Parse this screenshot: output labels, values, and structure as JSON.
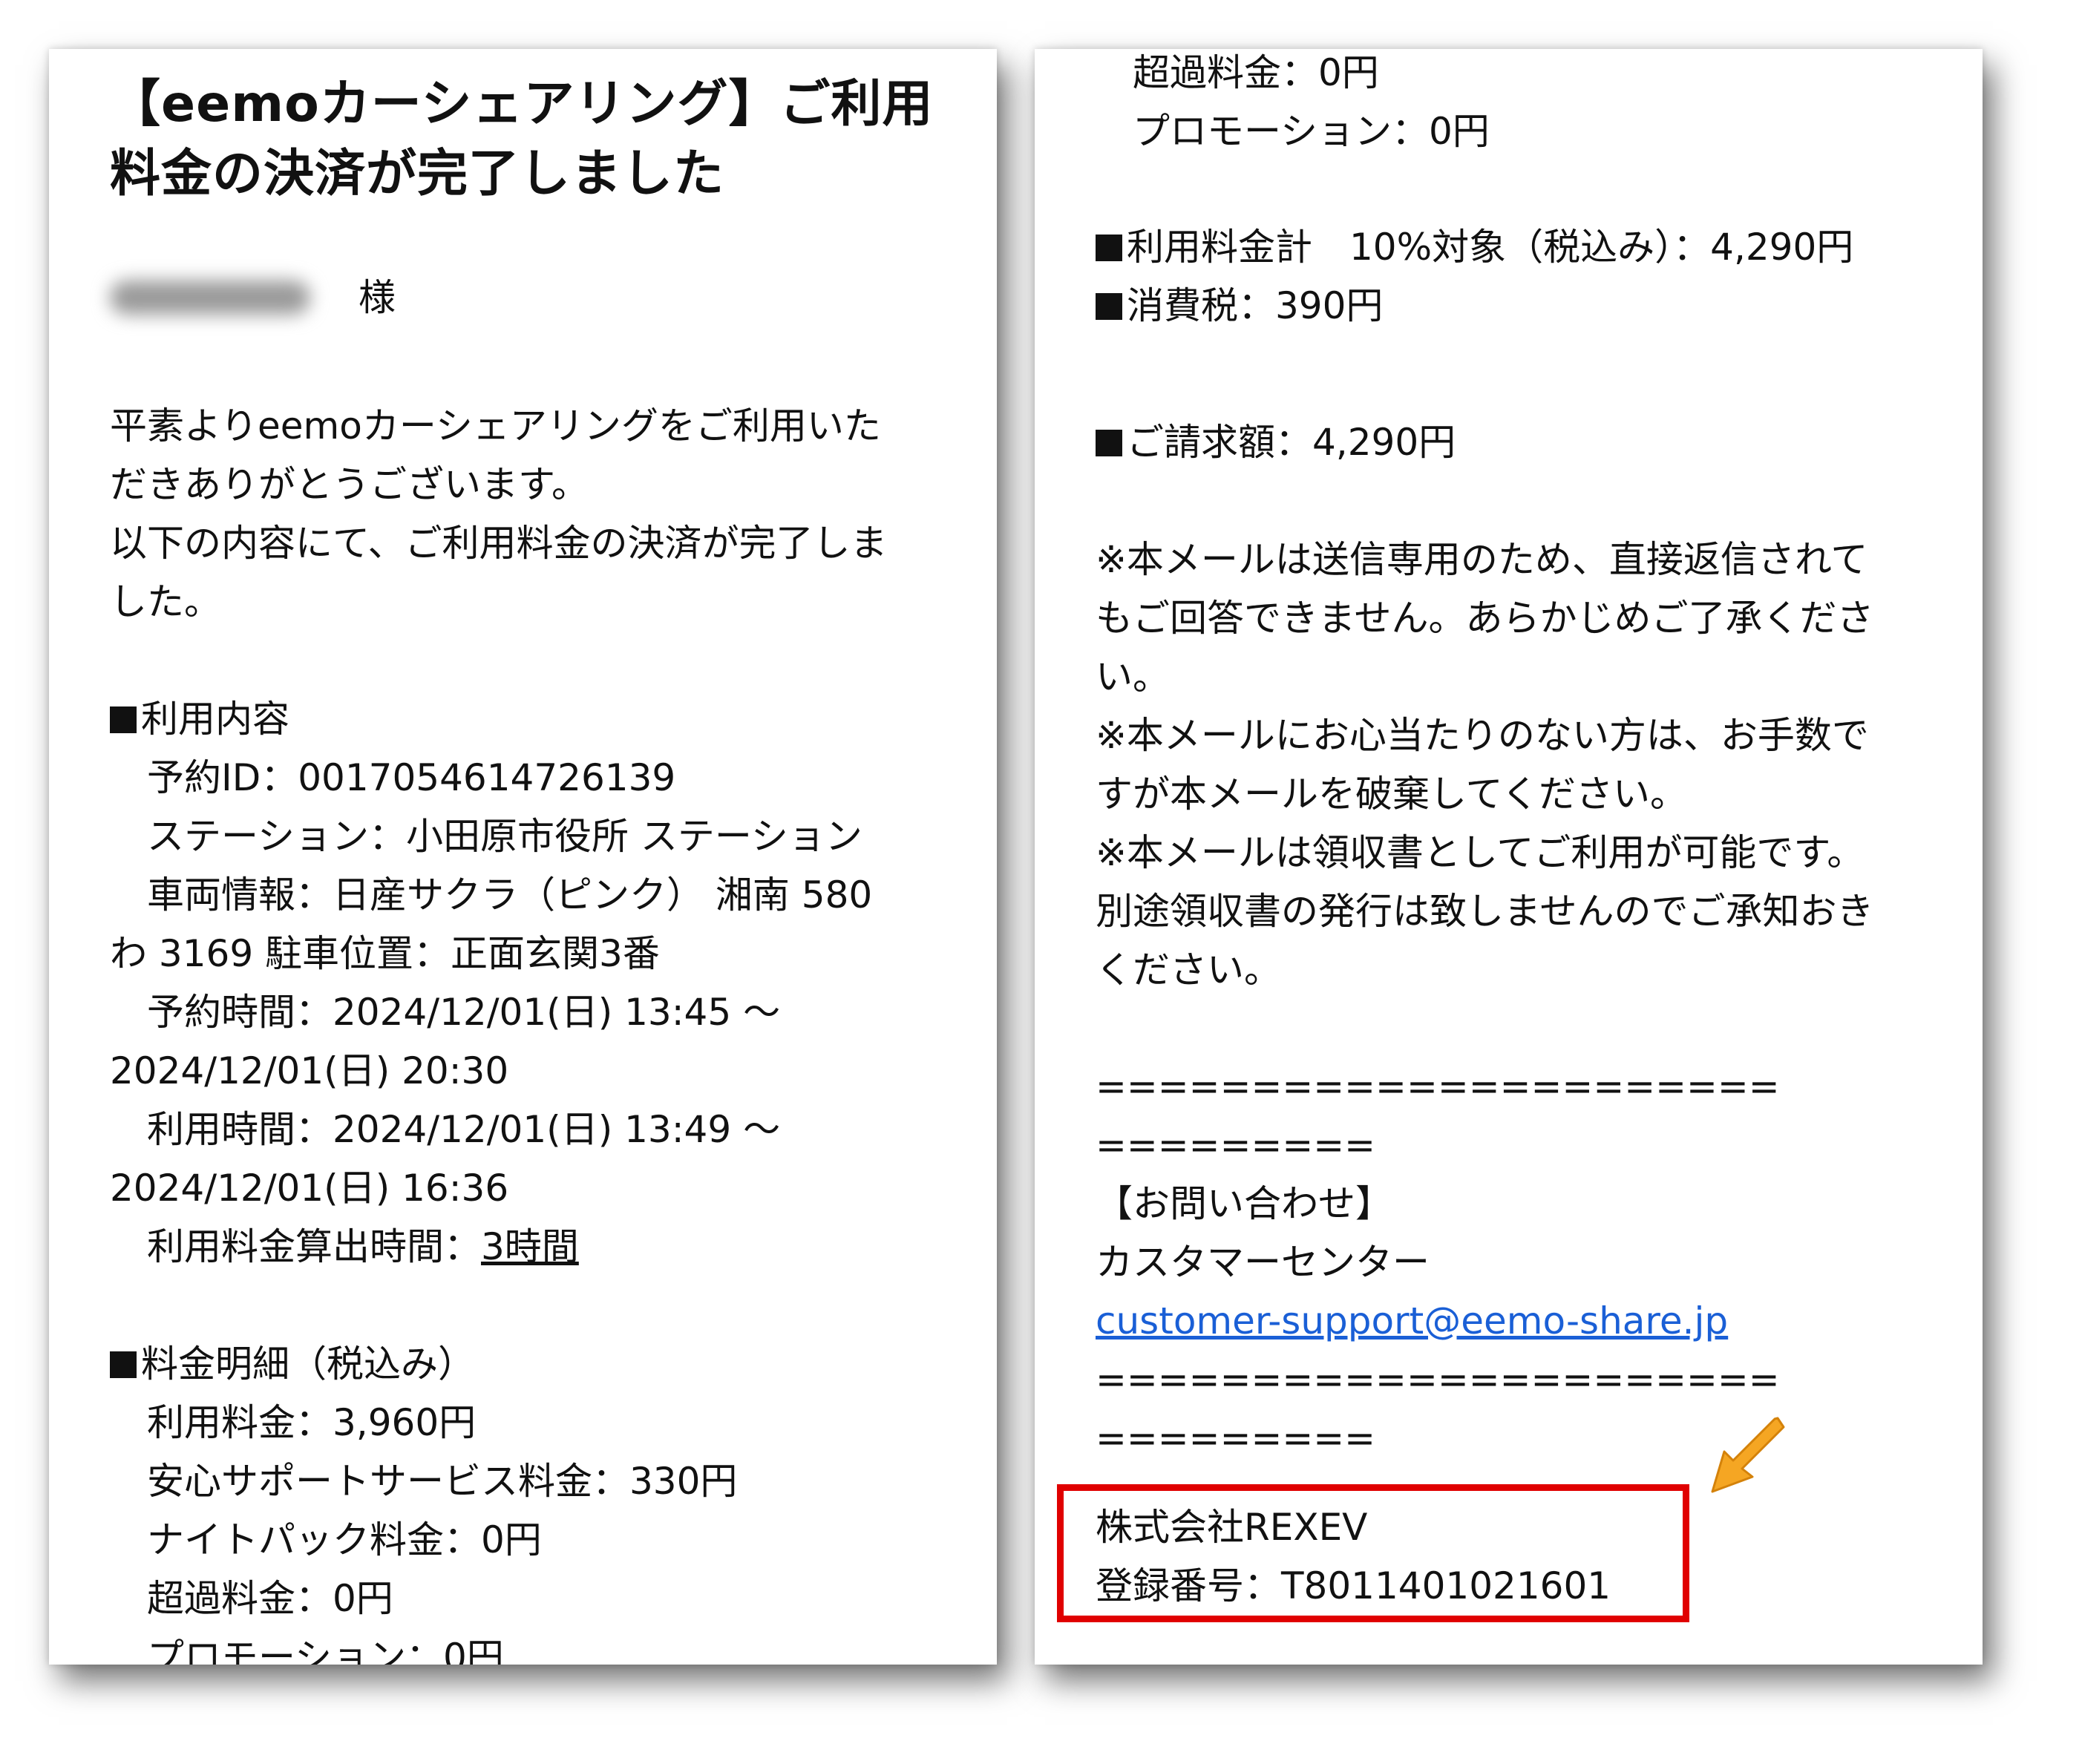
{
  "left_panel": {
    "title_lines": [
      "【eemoカーシェアリング】ご利用",
      "料金の決済が完了しました"
    ],
    "recipient_suffix": "様",
    "greeting_lines": [
      "平素よりeemoカーシェアリングをご利用いた",
      "だきありがとうございます。",
      "以下の内容にて、ご利用料金の決済が完了しま",
      "した。"
    ],
    "usage_heading": "利用内容",
    "usage_lines": [
      "予約ID：0017054614726139",
      "ステーション：小田原市役所 ステーション",
      "車両情報：日産サクラ（ピンク） 湘南 580",
      "わ 3169 駐車位置：正面玄関3番",
      "予約時間：2024/12/01(日) 13:45 〜",
      "2024/12/01(日) 20:30",
      "利用時間：2024/12/01(日) 13:49 〜",
      "2024/12/01(日) 16:36"
    ],
    "calc_time_label": "利用料金算出時間：",
    "calc_time_value": "3時間",
    "fee_heading": "料金明細（税込み）",
    "fee_lines": [
      "利用料金：3,960円",
      "安心サポートサービス料金：330円",
      "ナイトパック料金：0円",
      "超過料金：0円",
      "プロモーション：0円"
    ]
  },
  "right_panel": {
    "top_lines": [
      "超過料金：0円",
      "プロモーション：0円"
    ],
    "total_line": "利用料金計　10%対象（税込み）：4,290円",
    "tax_line": "消費税：390円",
    "billing_line": "ご請求額：4,290円",
    "notice_lines": [
      "※本メールは送信専用のため、直接返信されて",
      "もご回答できません。あらかじめご了承くださ",
      "い。",
      "※本メールにお心当たりのない方は、お手数で",
      "すが本メールを破棄してください。",
      "※本メールは領収書としてご利用が可能です。",
      "別途領収書の発行は致しませんのでご承知おき",
      "ください。"
    ],
    "separator_a": "======================",
    "separator_b": "=========",
    "contact_heading": "【お問い合わせ】",
    "contact_center": "カスタマーセンター",
    "contact_email": "customer-support@eemo-share.jp",
    "company_name": "株式会社REXEV",
    "registration_number": "登録番号：T8011401021601"
  },
  "colors": {
    "highlight_box": "#e00000",
    "arrow": "#f5a623",
    "link": "#1a5fd6"
  }
}
